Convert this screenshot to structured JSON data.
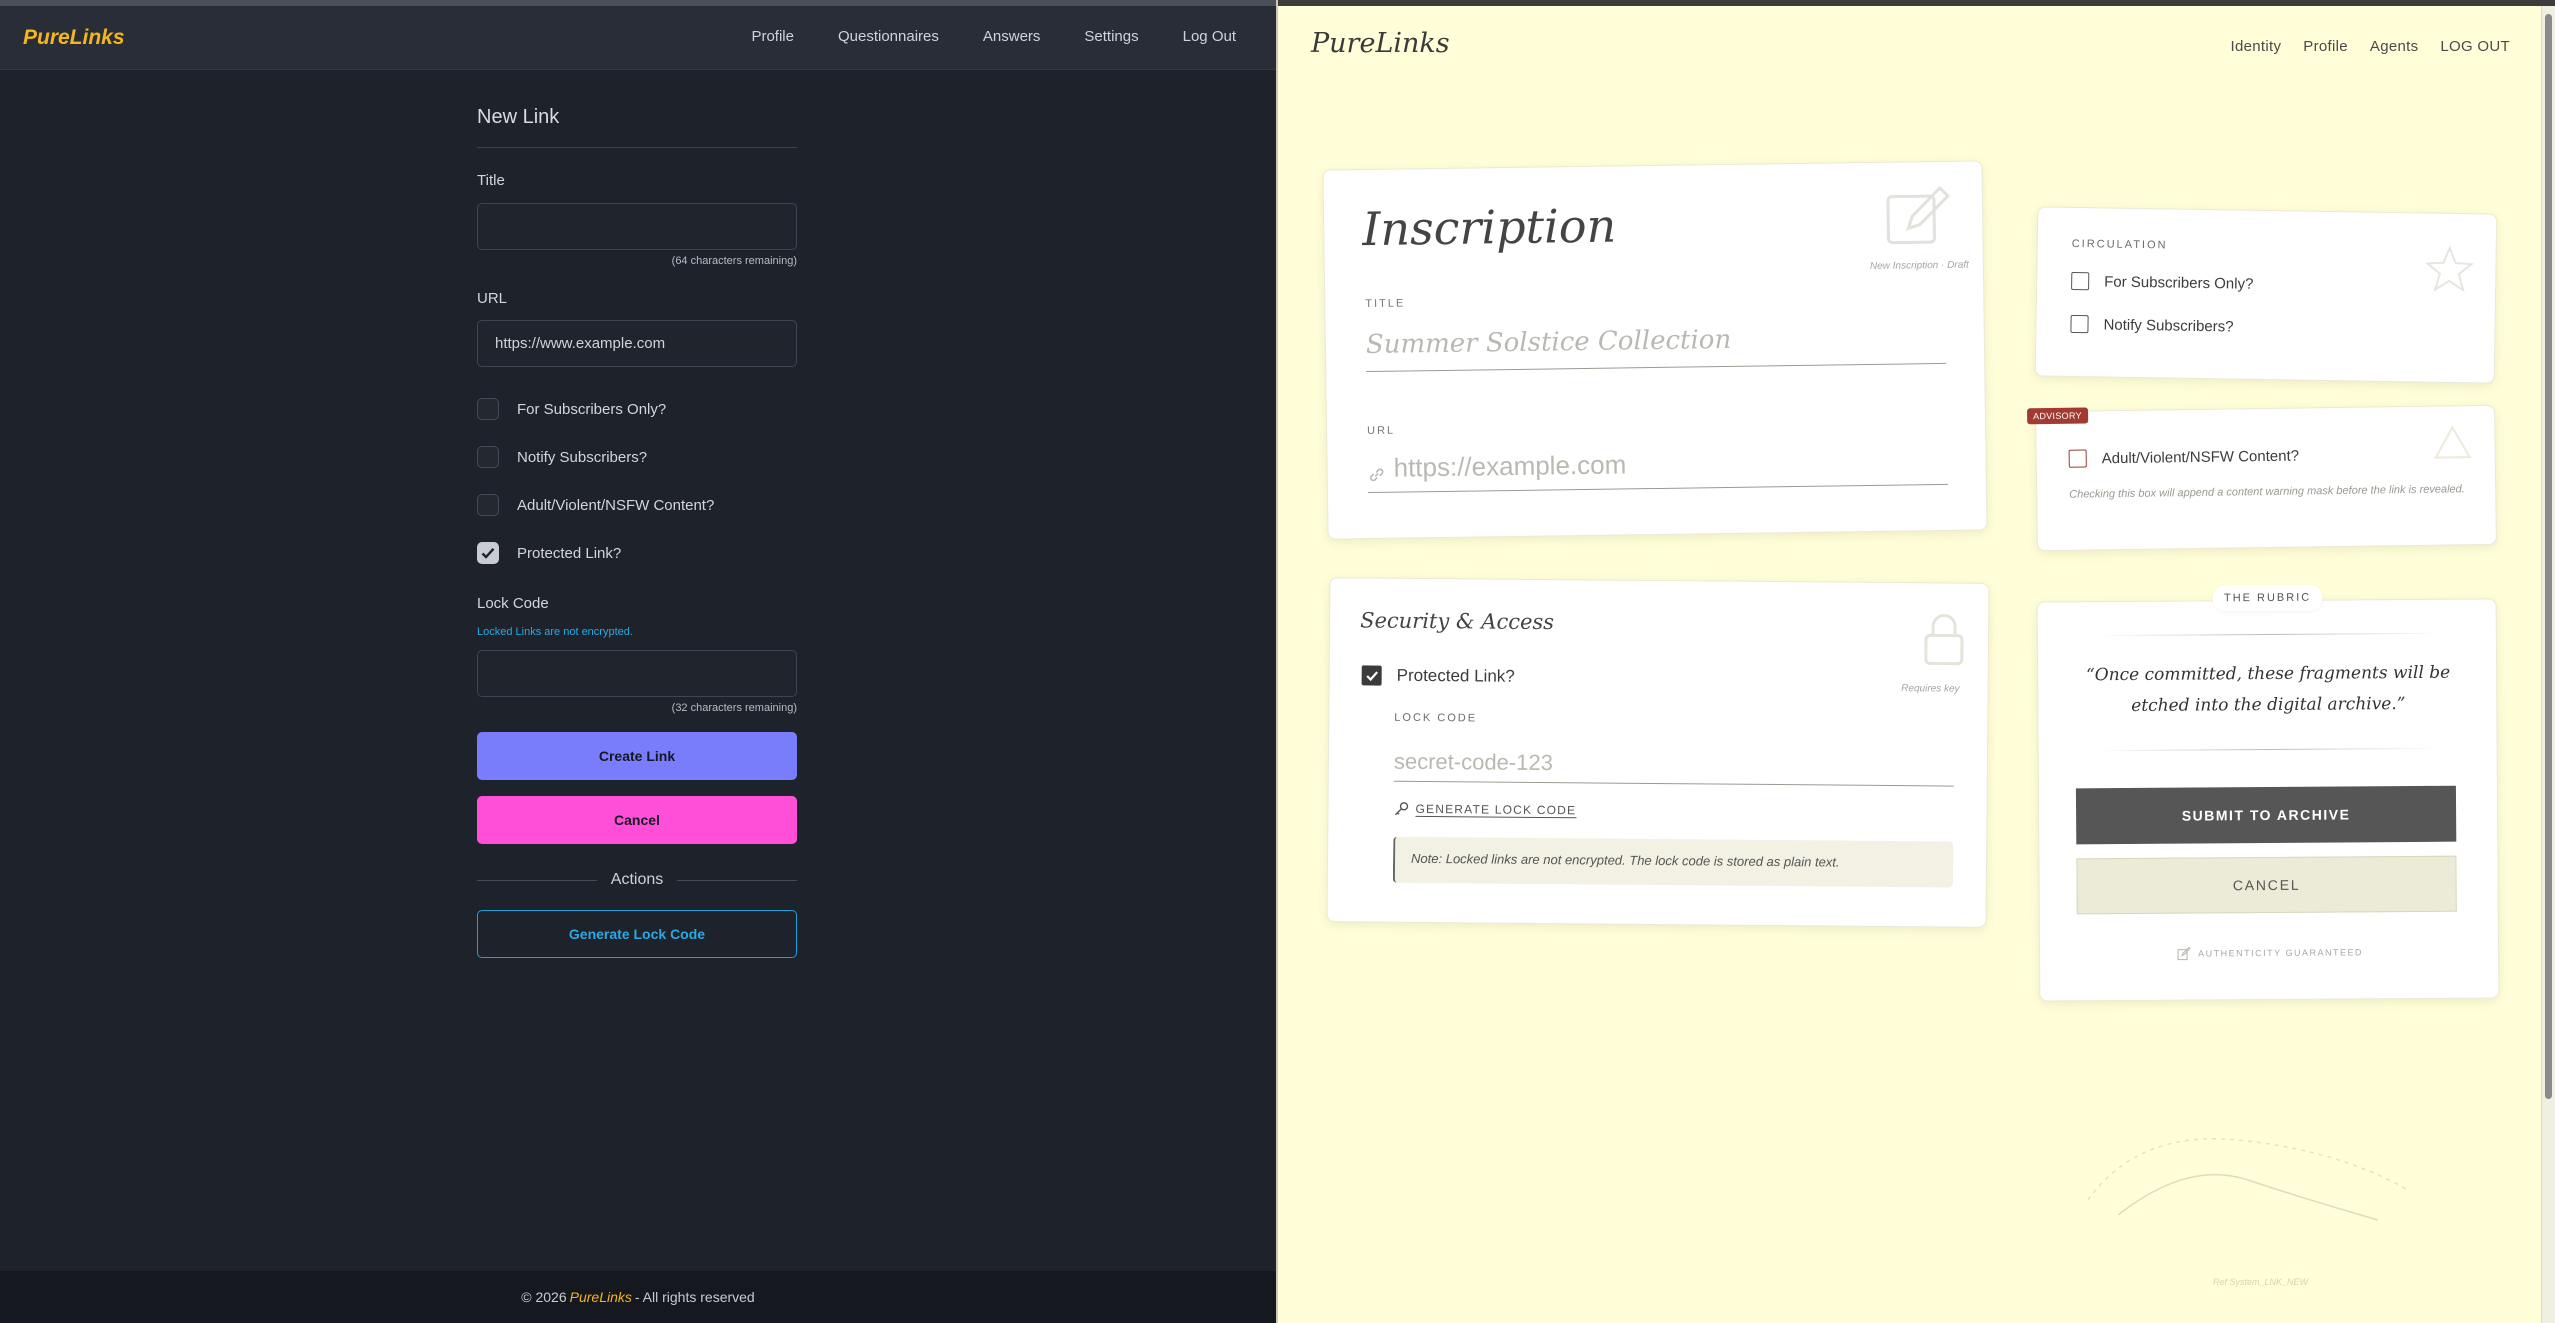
{
  "left": {
    "brand": "PureLinks",
    "nav": [
      "Profile",
      "Questionnaires",
      "Answers",
      "Settings",
      "Log Out"
    ],
    "form_title": "New Link",
    "title_label": "Title",
    "title_value": "",
    "title_hint": "(64 characters remaining)",
    "url_label": "URL",
    "url_value": "https://www.example.com",
    "checkboxes": [
      {
        "label": "For Subscribers Only?",
        "checked": false
      },
      {
        "label": "Notify Subscribers?",
        "checked": false
      },
      {
        "label": "Adult/Violent/NSFW Content?",
        "checked": false
      },
      {
        "label": "Protected Link?",
        "checked": true
      }
    ],
    "lock_label": "Lock Code",
    "lock_note": "Locked Links are not encrypted.",
    "lock_value": "",
    "lock_hint": "(32 characters remaining)",
    "create_label": "Create Link",
    "cancel_label": "Cancel",
    "actions_label": "Actions",
    "generate_label": "Generate Lock Code",
    "footer_pre": "© 2026",
    "footer_brand": "PureLinks",
    "footer_post": "- All rights reserved",
    "colors": {
      "brand": "#f4b61a",
      "create": "#7a7dfb",
      "cancel": "#ff4fd8",
      "outline": "#1ea2db"
    }
  },
  "right": {
    "brand": "PureLinks",
    "nav": [
      "Identity",
      "Profile",
      "Agents",
      "LOG OUT"
    ],
    "inscription": {
      "heading": "Inscription",
      "subtitle": "New Inscription · Draft",
      "title_label": "TITLE",
      "title_placeholder": "Summer Solstice Collection",
      "url_label": "URL",
      "url_placeholder": "https://example.com"
    },
    "security": {
      "heading": "Security & Access",
      "subtitle": "Requires key",
      "protected_label": "Protected Link?",
      "protected_checked": true,
      "lock_label": "LOCK CODE",
      "lock_placeholder": "secret-code-123",
      "generate_label": "GENERATE LOCK CODE",
      "note": "Note: Locked links are not encrypted. The lock code is stored as plain text."
    },
    "circulation": {
      "title": "CIRCULATION",
      "options": [
        {
          "label": "For Subscribers Only?",
          "checked": false
        },
        {
          "label": "Notify Subscribers?",
          "checked": false
        }
      ]
    },
    "advisory": {
      "badge": "ADVISORY",
      "label": "Adult/Violent/NSFW Content?",
      "checked": false,
      "description": "Checking this box will append a content warning mask before the link is revealed."
    },
    "rubric": {
      "tag": "THE RUBRIC",
      "quote": "“Once committed, these fragments will be etched into the digital archive.”",
      "submit_label": "SUBMIT TO ARCHIVE",
      "cancel_label": "CANCEL",
      "authenticity": "AUTHENTICITY GUARANTEED"
    },
    "ref_text": "Ref System_LNK_NEW",
    "colors": {
      "background": "#fffed8",
      "ink": "#3a3a3a",
      "advisory": "#a13a30",
      "submit": "#565656"
    }
  }
}
